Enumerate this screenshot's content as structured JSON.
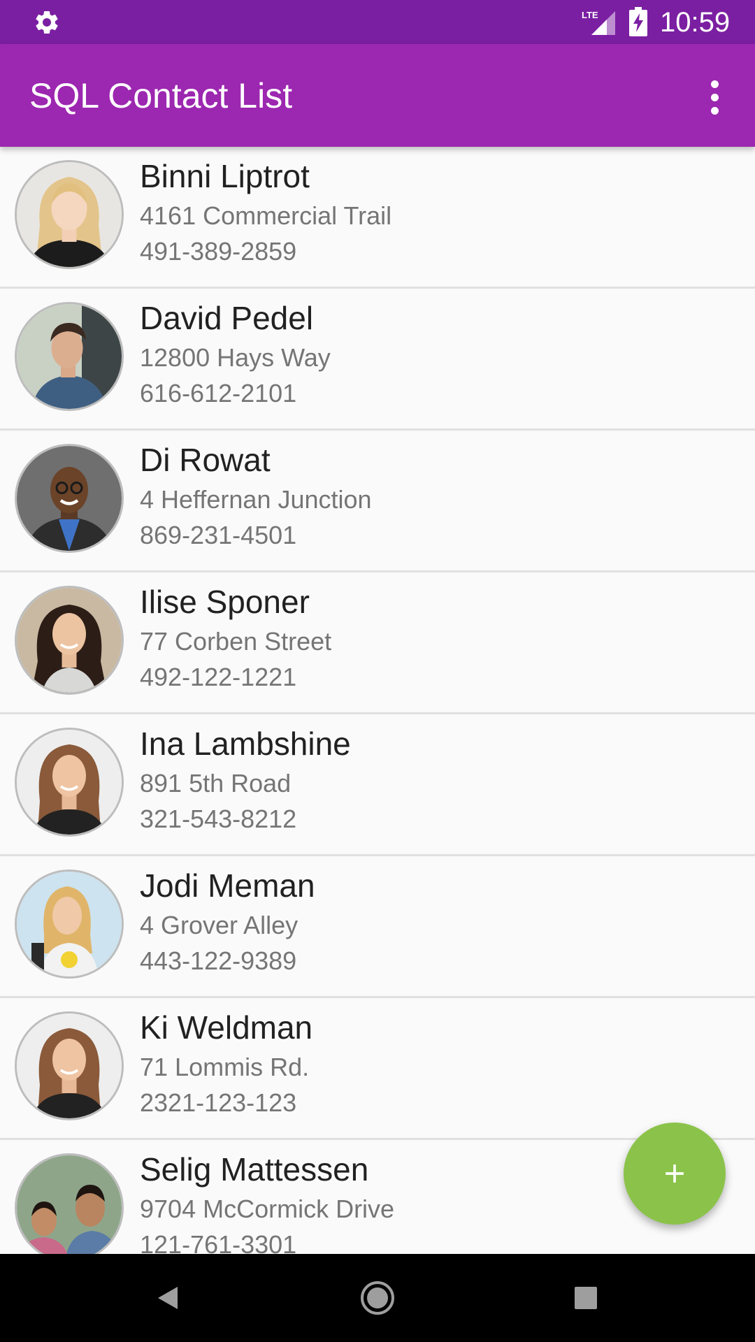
{
  "status_bar": {
    "time": "10:59",
    "icons": [
      "settings-icon",
      "lte-signal-icon",
      "battery-charging-icon"
    ],
    "background": "#7b1fa2"
  },
  "app_bar": {
    "title": "SQL Contact List",
    "menu_icon": "overflow-menu-icon",
    "background": "#9c27b0"
  },
  "contacts": [
    {
      "name": "Binni Liptrot",
      "address": "4161 Commercial Trail",
      "phone": "491-389-2859"
    },
    {
      "name": "David Pedel",
      "address": "12800 Hays Way",
      "phone": "616-612-2101"
    },
    {
      "name": "Di Rowat",
      "address": "4 Heffernan Junction",
      "phone": "869-231-4501"
    },
    {
      "name": "Ilise Sponer",
      "address": "77 Corben Street",
      "phone": "492-122-1221"
    },
    {
      "name": "Ina Lambshine",
      "address": "891 5th Road",
      "phone": "321-543-8212"
    },
    {
      "name": "Jodi Meman",
      "address": "4 Grover Alley",
      "phone": "443-122-9389"
    },
    {
      "name": "Ki Weldman",
      "address": "71 Lommis Rd.",
      "phone": "2321-123-123"
    },
    {
      "name": "Selig Mattessen",
      "address": "9704 McCormick Drive",
      "phone": "121-761-3301"
    }
  ],
  "fab": {
    "icon": "add-icon",
    "color": "#8bc34a"
  },
  "nav_bar": {
    "icons": [
      "back-icon",
      "home-icon",
      "recents-icon"
    ]
  }
}
